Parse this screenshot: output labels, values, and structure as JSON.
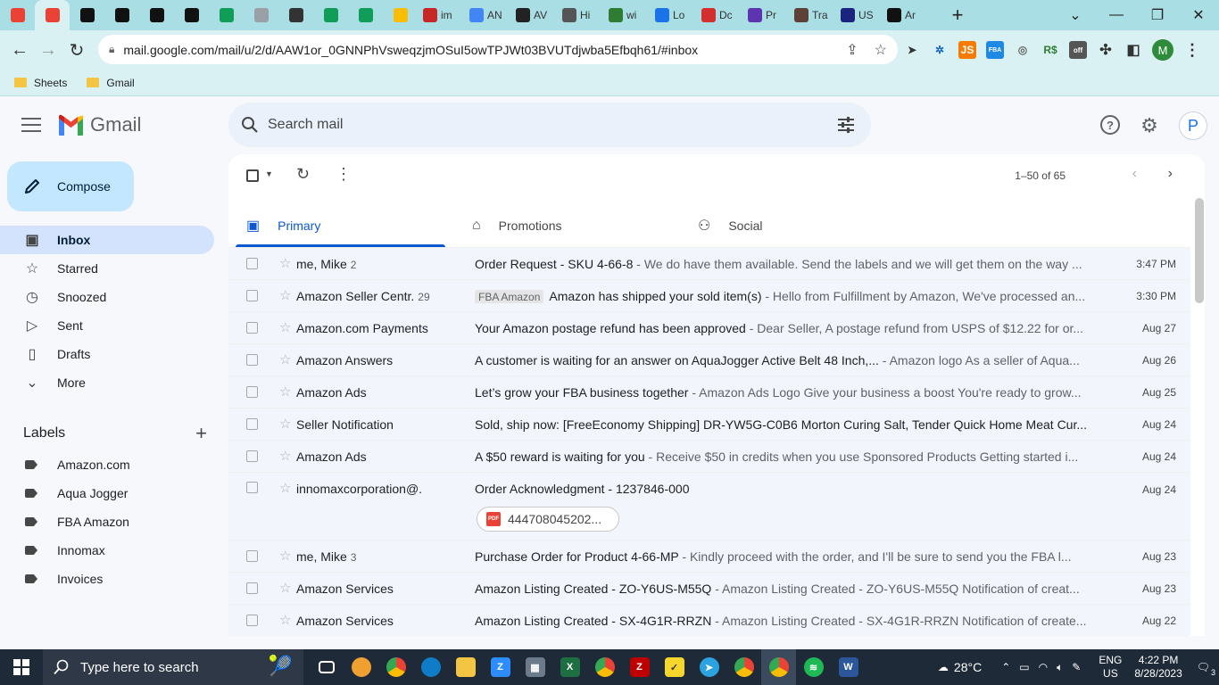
{
  "browser": {
    "tabs": [
      {
        "title": "",
        "icon": "gmail-icon",
        "color": "#ea4335"
      },
      {
        "title": "",
        "icon": "gmail-icon",
        "color": "#ea4335",
        "active": true
      },
      {
        "title": "",
        "icon": "amazon-icon",
        "color": "#111111"
      },
      {
        "title": "",
        "icon": "amazon-icon",
        "color": "#111111"
      },
      {
        "title": "",
        "icon": "amazon-icon",
        "color": "#111111"
      },
      {
        "title": "",
        "icon": "amazon-icon",
        "color": "#111111"
      },
      {
        "title": "",
        "icon": "sheets-icon",
        "color": "#0f9d58"
      },
      {
        "title": "",
        "icon": "gray-circle-icon",
        "color": "#9aa0a6"
      },
      {
        "title": "",
        "icon": "person-icon",
        "color": "#333333"
      },
      {
        "title": "",
        "icon": "sheets-icon",
        "color": "#0f9d58"
      },
      {
        "title": "",
        "icon": "sheets-icon",
        "color": "#0f9d58"
      },
      {
        "title": "",
        "icon": "drive-icon",
        "color": "#fbbc04"
      },
      {
        "title": "im",
        "icon": "red-v-icon",
        "color": "#c62828"
      },
      {
        "title": "AN",
        "icon": "colorful-icon",
        "color": "#4285f4"
      },
      {
        "title": "AV",
        "icon": "dark-circle-icon",
        "color": "#222222"
      },
      {
        "title": "Hi",
        "icon": "history-icon",
        "color": "#555555"
      },
      {
        "title": "wi",
        "icon": "green-check-icon",
        "color": "#2e7d32"
      },
      {
        "title": "Lo",
        "icon": "c-icon",
        "color": "#1a73e8"
      },
      {
        "title": "Dc",
        "icon": "heart-icon",
        "color": "#d32f2f"
      },
      {
        "title": "Pr",
        "icon": "purple-grid-icon",
        "color": "#5e35b1"
      },
      {
        "title": "Tra",
        "icon": "ups-icon",
        "color": "#5d4037"
      },
      {
        "title": "US",
        "icon": "usps-icon",
        "color": "#1a237e"
      },
      {
        "title": "Ar",
        "icon": "amazon-icon",
        "color": "#111111"
      }
    ],
    "url": "mail.google.com/mail/u/2/d/AAW1or_0GNNPhVsweqzjmOSuI5owTPJWt03BVUTdjwba5Efbqh61/#inbox",
    "bookmarks": [
      "Sheets",
      "Gmail"
    ],
    "profile_initial": "M"
  },
  "gmail": {
    "logo_text": "Gmail",
    "search_placeholder": "Search mail",
    "account_initial": "P",
    "compose_label": "Compose",
    "nav": [
      {
        "label": "Inbox",
        "icon": "inbox-icon",
        "active": true
      },
      {
        "label": "Starred",
        "icon": "star-icon"
      },
      {
        "label": "Snoozed",
        "icon": "clock-icon"
      },
      {
        "label": "Sent",
        "icon": "send-icon"
      },
      {
        "label": "Drafts",
        "icon": "draft-icon"
      },
      {
        "label": "More",
        "icon": "chevron-down-icon"
      }
    ],
    "labels_heading": "Labels",
    "labels": [
      "Amazon.com",
      "Aqua Jogger",
      "FBA Amazon",
      "Innomax",
      "Invoices"
    ],
    "pager": "1–50 of 65",
    "category_tabs": [
      {
        "label": "Primary",
        "icon": "inbox-icon",
        "active": true
      },
      {
        "label": "Promotions",
        "icon": "tag-icon"
      },
      {
        "label": "Social",
        "icon": "people-icon"
      }
    ],
    "emails": [
      {
        "sender": "me, Mike",
        "count": "2",
        "chip": "",
        "subject": "Order Request - SKU 4-66-8",
        "snippet": " - We do have them available. Send the labels and we will get them on the way ...",
        "date": "3:47 PM"
      },
      {
        "sender": "Amazon Seller Centr.",
        "count": "29",
        "chip": "FBA Amazon",
        "subject": "Amazon has shipped your sold item(s)",
        "snippet": " - Hello from Fulfillment by Amazon, We've processed an...",
        "date": "3:30 PM"
      },
      {
        "sender": "Amazon.com Payments",
        "count": "",
        "chip": "",
        "subject": "Your Amazon postage refund has been approved",
        "snippet": " - Dear Seller, A postage refund from USPS of $12.22 for or...",
        "date": "Aug 27"
      },
      {
        "sender": "Amazon Answers",
        "count": "",
        "chip": "",
        "subject": "A customer is waiting for an answer on AquaJogger Active Belt 48 Inch,...",
        "snippet": " - Amazon logo As a seller of Aqua...",
        "date": "Aug 26"
      },
      {
        "sender": "Amazon Ads",
        "count": "",
        "chip": "",
        "subject": "Let’s grow your FBA business together",
        "snippet": " - Amazon Ads Logo Give your business a boost You're ready to grow...",
        "date": "Aug 25"
      },
      {
        "sender": "Seller Notification",
        "count": "",
        "chip": "",
        "subject": "Sold, ship now: [FreeEconomy Shipping] DR-YW5G-C0B6 Morton Curing Salt, Tender Quick Home Meat Cur...",
        "snippet": "",
        "date": "Aug 24"
      },
      {
        "sender": "Amazon Ads",
        "count": "",
        "chip": "",
        "subject": "A $50 reward is waiting for you",
        "snippet": " - Receive $50 in credits when you use Sponsored Products Getting started i...",
        "date": "Aug 24"
      },
      {
        "sender": "innomaxcorporation@.",
        "count": "",
        "chip": "",
        "subject": "Order Acknowledgment - 1237846-000",
        "snippet": "",
        "date": "Aug 24",
        "attachment": "444708045202..."
      },
      {
        "sender": "me, Mike",
        "count": "3",
        "chip": "",
        "subject": "Purchase Order for Product 4-66-MP",
        "snippet": " - Kindly proceed with the order, and I'll be sure to send you the FBA l...",
        "date": "Aug 23"
      },
      {
        "sender": "Amazon Services",
        "count": "",
        "chip": "",
        "subject": "Amazon Listing Created - ZO-Y6US-M55Q",
        "snippet": " - Amazon Listing Created - ZO-Y6US-M55Q Notification of creat...",
        "date": "Aug 23"
      },
      {
        "sender": "Amazon Services",
        "count": "",
        "chip": "",
        "subject": "Amazon Listing Created - SX-4G1R-RRZN",
        "snippet": " - Amazon Listing Created - SX-4G1R-RRZN Notification of create...",
        "date": "Aug 22"
      }
    ]
  },
  "taskbar": {
    "search_placeholder": "Type here to search",
    "weather": "28°C",
    "language": "ENG",
    "region": "US",
    "time": "4:22 PM",
    "date": "8/28/2023",
    "notification_count": "3"
  }
}
